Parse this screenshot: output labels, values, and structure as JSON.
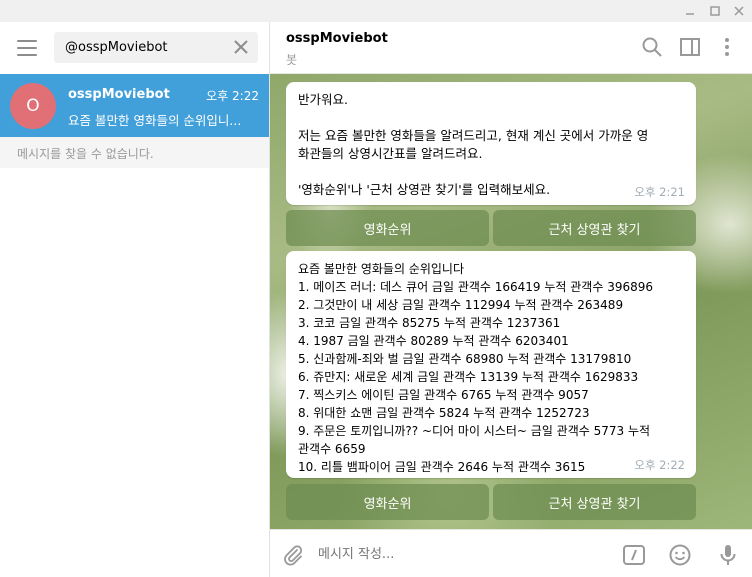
{
  "search": {
    "value": "@osspMoviebot"
  },
  "chat_list": {
    "item": {
      "avatar_letter": "O",
      "name": "osspMoviebot",
      "time": "오후 2:22",
      "preview": "요즘 볼만한 영화들의 순위입니..."
    },
    "no_messages": "메시지를 찾을 수 없습니다."
  },
  "header": {
    "title": "osspMoviebot",
    "subtitle": "봇"
  },
  "messages": [
    {
      "lines": [
        "반가워요.",
        "",
        "저는 요즘 볼만한 영화들을 알려드리고, 현재 계신 곳에서 가까운 영",
        "화관들의 상영시간표를 알려드려요.",
        "",
        "'영화순위'나 '근처 상영관 찾기'를 입력해보세요."
      ],
      "time": "오후 2:21"
    },
    {
      "lines": [
        "요즘 볼만한 영화들의 순위입니다",
        "1. 메이즈 러너: 데스 큐어 금일 관객수 166419 누적 관객수 396896",
        "2. 그것만이 내 세상 금일 관객수 112994 누적 관객수 263489",
        "3. 코코 금일 관객수 85275 누적 관객수 1237361",
        "4. 1987 금일 관객수 80289 누적 관객수 6203401",
        "5. 신과함께-죄와 벌 금일 관객수 68980 누적 관객수 13179810",
        "6. 쥬만지: 새로운 세계 금일 관객수 13139 누적 관객수 1629833",
        "7. 찍스키스 에이틴 금일 관객수 6765 누적 관객수 9057",
        "8. 위대한 쇼맨 금일 관객수 5824 누적 관객수 1252723",
        "9. 주문은 토끼입니까?? ~디어 마이 시스터~ 금일 관객수 5773 누적",
        "관객수 6659",
        "10. 리틀 뱀파이어 금일 관객수 2646 누적 관객수 3615"
      ],
      "time": "오후 2:22"
    }
  ],
  "keyboard": {
    "left": "영화순위",
    "right": "근처 상영관 찾기"
  },
  "composer": {
    "placeholder": "메시지 작성..."
  },
  "icons": {
    "menu": "hamburger-icon",
    "clear": "close-icon",
    "search": "search-icon",
    "sidebar": "sidebar-toggle-icon",
    "more": "more-vertical-icon",
    "attach": "paperclip-icon",
    "commands": "slash-command-icon",
    "emoji": "emoji-icon",
    "voice": "microphone-icon"
  },
  "colors": {
    "accent": "#419fd9",
    "avatar": "#e17076",
    "keyboard_button": "#6e8c50"
  }
}
